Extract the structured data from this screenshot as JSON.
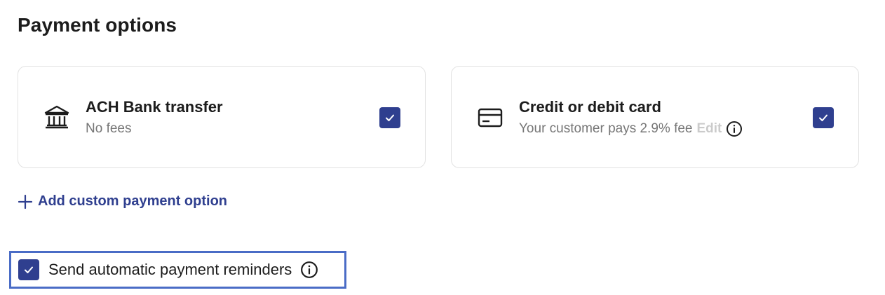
{
  "page": {
    "title": "Payment options"
  },
  "options": [
    {
      "name": "ACH Bank transfer",
      "subtitle": "No fees",
      "icon": "bank-icon",
      "checked": true
    },
    {
      "name": "Credit or debit card",
      "subtitle": "Your customer pays 2.9% fee",
      "edit_label": "Edit",
      "icon": "credit-card-icon",
      "checked": true
    }
  ],
  "add_custom": {
    "label": "Add custom payment option",
    "icon": "plus-icon"
  },
  "reminders": {
    "label": "Send automatic payment reminders",
    "checked": true,
    "icon": "info-icon"
  },
  "colors": {
    "accent": "#2f3f8f",
    "focus_outline": "#4a6cc6",
    "muted_text": "#767676",
    "disabled_text": "#cbcbcb",
    "card_border": "#e2e2e2"
  }
}
